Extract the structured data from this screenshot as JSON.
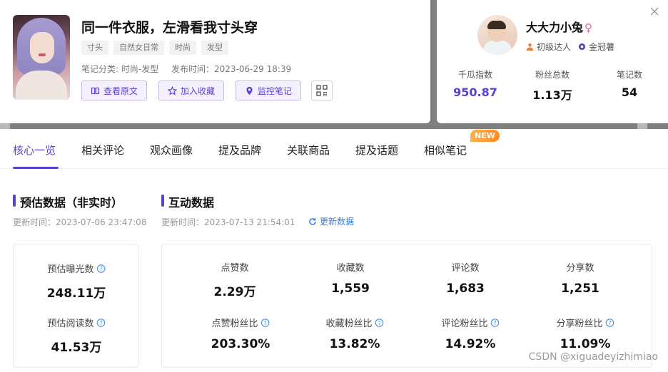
{
  "note": {
    "title": "同一件衣服，左滑看我寸头穿",
    "tags": [
      "寸头",
      "自然女日常",
      "时尚",
      "发型"
    ],
    "category": "笔记分类: 时尚-发型",
    "publish_time": "发布时间：2023-06-29 18:39",
    "actions": [
      {
        "label": "查看原文",
        "icon": "book-icon"
      },
      {
        "label": "加入收藏",
        "icon": "star-icon"
      },
      {
        "label": "监控笔记",
        "icon": "location-pin-icon"
      }
    ],
    "qr_icon": "qrcode-icon"
  },
  "author": {
    "name": "大大力小兔",
    "gender_icon": "female-icon",
    "badges": [
      {
        "label": "初级达人",
        "icon": "person-icon",
        "color": "#f07d3a"
      },
      {
        "label": "金冠薯",
        "icon": "crown-icon",
        "color": "#5b3fd1"
      }
    ],
    "stats": [
      {
        "label": "千瓜指数",
        "value": "950.87"
      },
      {
        "label": "粉丝总数",
        "value": "1.13万"
      },
      {
        "label": "笔记数",
        "value": "54"
      }
    ]
  },
  "tabs": [
    "核心一览",
    "相关评论",
    "观众画像",
    "提及品牌",
    "关联商品",
    "提及话题",
    "相似笔记"
  ],
  "active_tab": "核心一览",
  "new_badge": "NEW",
  "estimate": {
    "title": "预估数据（非实时）",
    "updated": "更新时间：2023-07-06 23:47:08",
    "metrics": [
      {
        "label": "预估曝光数",
        "value": "248.11万"
      },
      {
        "label": "预估阅读数",
        "value": "41.53万"
      }
    ]
  },
  "interaction": {
    "title": "互动数据",
    "updated": "更新时间：2023-07-13 21:54:01",
    "refresh_label": "更新数据",
    "row1": [
      {
        "label": "点赞数",
        "value": "2.29万"
      },
      {
        "label": "收藏数",
        "value": "1,559"
      },
      {
        "label": "评论数",
        "value": "1,683"
      },
      {
        "label": "分享数",
        "value": "1,251"
      }
    ],
    "row2": [
      {
        "label": "点赞粉丝比",
        "value": "203.30%"
      },
      {
        "label": "收藏粉丝比",
        "value": "13.82%"
      },
      {
        "label": "评论粉丝比",
        "value": "14.92%"
      },
      {
        "label": "分享粉丝比",
        "value": "11.09%"
      }
    ]
  },
  "watermark": "CSDN @xiguadeyizhimiao",
  "colors": {
    "accent": "#5b3fd1",
    "link": "#2f7ef5",
    "new_badge": "#ff8a1f"
  }
}
